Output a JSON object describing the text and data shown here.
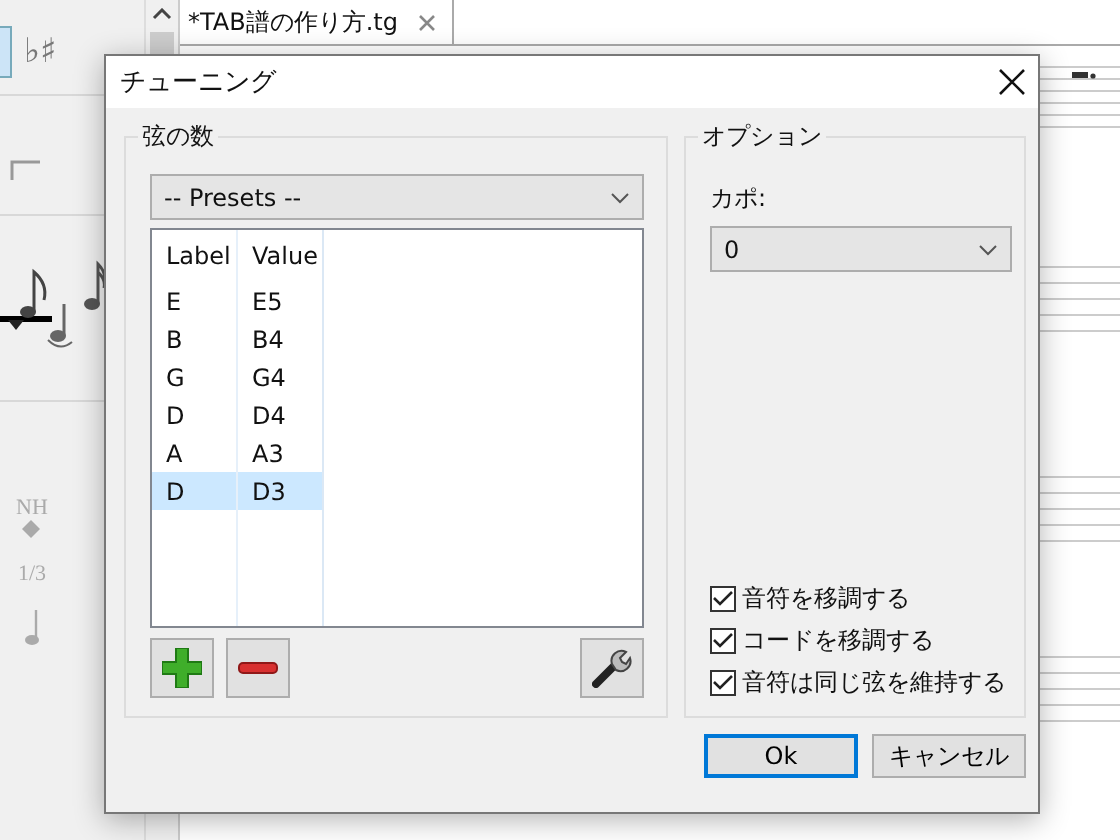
{
  "palette": {
    "accidentals": "♭♯",
    "harmonic": "NH",
    "tuplet": "1/3"
  },
  "editor": {
    "tab": {
      "title": "*TAB譜の作り方.tg",
      "selected": true
    }
  },
  "dialog": {
    "title": "チューニング",
    "strings_group": {
      "label": "弦の数",
      "presets": "-- Presets --",
      "table": {
        "columns": [
          "Label",
          "Value"
        ],
        "rows": [
          {
            "label": "E",
            "value": "E5",
            "selected": false
          },
          {
            "label": "B",
            "value": "B4",
            "selected": false
          },
          {
            "label": "G",
            "value": "G4",
            "selected": false
          },
          {
            "label": "D",
            "value": "D4",
            "selected": false
          },
          {
            "label": "A",
            "value": "A3",
            "selected": false
          },
          {
            "label": "D",
            "value": "D3",
            "selected": true
          }
        ]
      }
    },
    "options_group": {
      "label": "オプション",
      "capo_label": "カポ:",
      "capo_value": "0",
      "checkboxes": [
        {
          "label": "音符を移調する",
          "checked": true
        },
        {
          "label": "コードを移調する",
          "checked": true
        },
        {
          "label": "音符は同じ弦を維持する",
          "checked": true
        }
      ]
    },
    "buttons": [
      {
        "label": "Ok",
        "default": true
      },
      {
        "label": "キャンセル",
        "default": false
      }
    ]
  }
}
